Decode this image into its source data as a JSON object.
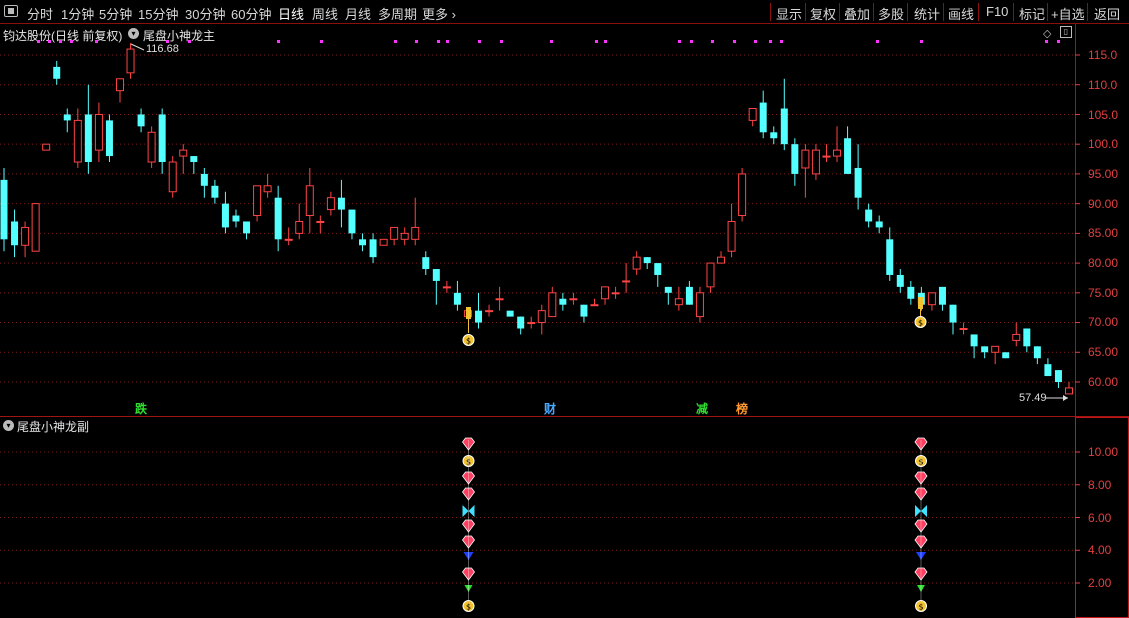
{
  "toolbar": {
    "left_items": [
      "分时",
      "1分钟",
      "5分钟",
      "15分钟",
      "30分钟",
      "60分钟",
      "日线",
      "周线",
      "月线",
      "多周期",
      "更多 ›"
    ],
    "active": "日线",
    "right_items": [
      "显示",
      "复权",
      "叠加",
      "多股",
      "统计",
      "画线",
      "F10",
      "标记",
      "+自选",
      "返回"
    ]
  },
  "main_panel": {
    "stock_title": "钧达股份(日线 前复权)",
    "indicator_name": "尾盘小神龙主",
    "high_label": "116.68",
    "low_label": "57.49",
    "y_ticks": [
      "115.0",
      "110.0",
      "105.0",
      "100.0",
      "95.00",
      "90.00",
      "85.00",
      "80.00",
      "75.00",
      "70.00",
      "65.00",
      "60.00"
    ],
    "markers": [
      "跌",
      "财",
      "减",
      "榜"
    ]
  },
  "sub_panel": {
    "indicator_name": "尾盘小神龙副",
    "y_ticks": [
      "10.00",
      "8.00",
      "6.00",
      "4.00",
      "2.00"
    ]
  },
  "colors": {
    "up": "#ff4444",
    "down": "#54ffff",
    "grid": "#7a1a1a",
    "axis": "#e04040",
    "dot": "#ff33ff"
  },
  "chart_data": {
    "type": "candlestick",
    "ylim": [
      55.5,
      118.5
    ],
    "candles": [
      [
        94,
        84,
        82,
        96
      ],
      [
        87,
        83,
        81,
        89
      ],
      [
        83,
        86,
        81,
        87
      ],
      [
        82,
        90,
        82,
        90
      ],
      [
        99,
        100,
        99,
        100
      ],
      [
        113,
        111,
        110,
        114
      ],
      [
        105,
        104,
        102,
        106
      ],
      [
        97,
        104,
        96,
        106
      ],
      [
        105,
        97,
        95,
        110
      ],
      [
        99,
        105,
        97,
        107
      ],
      [
        104,
        98,
        97,
        105
      ],
      [
        109,
        111,
        107,
        111
      ],
      [
        112,
        116,
        111,
        117
      ],
      [
        105,
        103,
        102,
        106
      ],
      [
        97,
        102,
        96,
        103
      ],
      [
        105,
        97,
        95,
        106
      ],
      [
        92,
        97,
        91,
        98
      ],
      [
        98,
        99,
        95,
        100
      ],
      [
        98,
        97,
        95,
        98
      ],
      [
        95,
        93,
        91,
        96
      ],
      [
        93,
        91,
        90,
        94
      ],
      [
        90,
        86,
        85,
        92
      ],
      [
        88,
        87,
        86,
        89
      ],
      [
        87,
        85,
        84,
        87
      ],
      [
        88,
        93,
        87,
        93
      ],
      [
        92,
        93,
        91,
        95
      ],
      [
        91,
        84,
        82,
        93
      ],
      [
        84,
        84,
        83,
        86
      ],
      [
        85,
        87,
        84,
        90
      ],
      [
        88,
        93,
        85,
        96
      ],
      [
        87,
        87,
        85,
        88
      ],
      [
        89,
        91,
        88,
        92
      ],
      [
        91,
        89,
        86,
        94
      ],
      [
        89,
        85,
        84,
        89
      ],
      [
        84,
        83,
        82,
        85
      ],
      [
        84,
        81,
        80,
        85
      ],
      [
        83,
        84,
        83,
        84
      ],
      [
        84,
        86,
        83,
        86
      ],
      [
        84,
        85,
        83,
        86
      ],
      [
        84,
        86,
        83,
        91
      ],
      [
        81,
        79,
        78,
        82
      ],
      [
        79,
        77,
        73,
        79
      ],
      [
        76,
        76,
        75,
        77
      ],
      [
        75,
        73,
        72,
        77
      ],
      [
        71,
        72,
        71,
        72
      ],
      [
        72,
        70,
        69,
        75
      ],
      [
        72,
        72,
        71,
        73
      ],
      [
        74,
        74,
        72,
        76
      ],
      [
        72,
        71,
        71,
        72
      ],
      [
        71,
        69,
        68,
        71
      ],
      [
        70,
        70,
        69,
        71
      ],
      [
        70,
        72,
        68,
        73
      ],
      [
        71,
        75,
        71,
        76
      ],
      [
        74,
        73,
        72,
        75
      ],
      [
        74,
        74,
        73,
        75
      ],
      [
        73,
        71,
        70,
        73
      ],
      [
        73,
        73,
        73,
        74
      ],
      [
        74,
        76,
        73,
        76
      ],
      [
        75,
        75,
        74,
        76
      ],
      [
        77,
        77,
        75,
        80
      ],
      [
        79,
        81,
        78,
        82
      ],
      [
        81,
        80,
        79,
        81
      ],
      [
        80,
        78,
        76,
        80
      ],
      [
        76,
        75,
        73,
        76
      ],
      [
        73,
        74,
        72,
        76
      ],
      [
        76,
        73,
        73,
        77
      ],
      [
        71,
        75,
        70,
        76
      ],
      [
        76,
        80,
        75,
        80
      ],
      [
        80,
        81,
        80,
        82
      ],
      [
        82,
        87,
        81,
        90
      ],
      [
        88,
        95,
        87,
        96
      ],
      [
        104,
        106,
        103,
        106
      ],
      [
        107,
        102,
        101,
        109
      ],
      [
        102,
        101,
        100,
        103
      ],
      [
        106,
        100,
        99,
        111
      ],
      [
        100,
        95,
        93,
        101
      ],
      [
        96,
        99,
        91,
        100
      ],
      [
        95,
        99,
        94,
        100
      ],
      [
        98,
        98,
        97,
        100
      ],
      [
        98,
        99,
        97,
        103
      ],
      [
        101,
        95,
        95,
        103
      ],
      [
        96,
        91,
        89,
        100
      ],
      [
        89,
        87,
        86,
        90
      ],
      [
        87,
        86,
        85,
        88
      ],
      [
        84,
        78,
        77,
        86
      ],
      [
        78,
        76,
        75,
        79
      ],
      [
        76,
        74,
        73,
        77
      ],
      [
        75,
        73,
        72,
        76
      ],
      [
        73,
        75,
        72,
        75
      ],
      [
        76,
        73,
        72,
        76
      ],
      [
        73,
        70,
        68,
        73
      ],
      [
        69,
        69,
        68,
        70
      ],
      [
        68,
        66,
        64,
        68
      ],
      [
        66,
        65,
        64,
        66
      ],
      [
        65,
        66,
        63,
        66
      ],
      [
        65,
        64,
        64,
        65
      ],
      [
        67,
        68,
        66,
        70
      ],
      [
        69,
        66,
        65,
        69
      ],
      [
        66,
        64,
        63,
        66
      ],
      [
        63,
        61,
        61,
        64
      ],
      [
        62,
        60,
        59,
        62
      ],
      [
        58,
        59,
        58,
        60
      ]
    ]
  }
}
